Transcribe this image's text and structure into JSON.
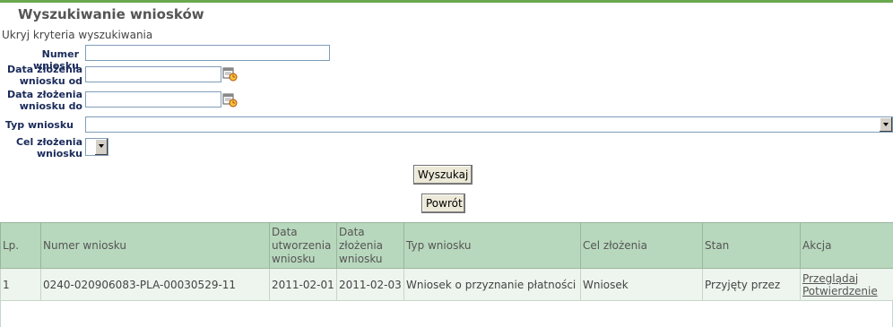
{
  "page": {
    "title": "Wyszukiwanie wniosków",
    "toggle_criteria": "Ukryj kryteria wyszukiwania"
  },
  "form": {
    "numer_label": "Numer wniosku",
    "numer_value": "",
    "data_od_label_1": "Data złożenia",
    "data_od_label_2": "wniosku od",
    "data_od_value": "",
    "data_do_label_1": "Data złożenia",
    "data_do_label_2": "wniosku do",
    "data_do_value": "",
    "typ_label": "Typ wniosku",
    "typ_value": "",
    "cel_label_1": "Cel złożenia",
    "cel_label_2": "wniosku",
    "cel_value": "",
    "search_button": "Wyszukaj",
    "back_button": "Powrót",
    "calendar_icon": "calendar-clock-icon"
  },
  "table": {
    "headers": [
      "Lp.",
      "Numer wniosku",
      "Data utworzenia wniosku",
      "Data złożenia wniosku",
      "Typ wniosku",
      "Cel złożenia",
      "Stan",
      "Akcja"
    ],
    "rows": [
      {
        "lp": "1",
        "numer": "0240-020906083-PLA-00030529-11",
        "data_utworzenia": "2011-02-01",
        "data_zlozenia": "2011-02-03",
        "typ": "Wniosek o przyznanie płatności",
        "cel": "Wniosek",
        "stan": "Przyjęty przez",
        "akcja_1": "Przeglądaj",
        "akcja_2": "Potwierdzenie"
      }
    ]
  },
  "colors": {
    "accent_line": "#6aa84f",
    "header_bg": "#b8d8bd",
    "row_bg": "#edf5ee"
  }
}
